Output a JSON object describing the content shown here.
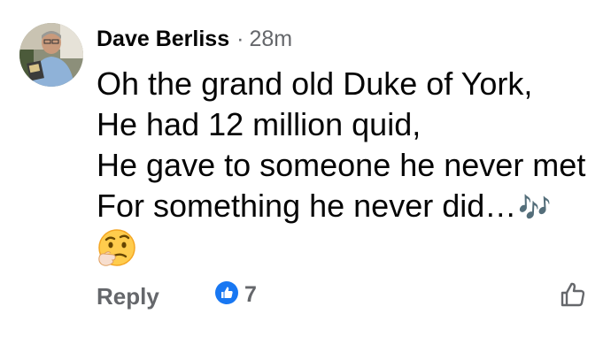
{
  "comment": {
    "author": "Dave Berliss",
    "separator": "·",
    "time": "28m",
    "lines": [
      "Oh the grand old Duke of York,",
      "He had 12 million quid,",
      "He gave to someone he never met",
      "For something he never did…"
    ],
    "music_notes": "🎶",
    "emoji_icon": "thinking-face-icon"
  },
  "actions": {
    "reply_label": "Reply",
    "reaction_count": "7",
    "reaction_icon": "like-badge-icon",
    "like_icon": "thumbs-up-outline-icon"
  },
  "colors": {
    "text": "#050505",
    "secondary": "#65676b",
    "like_blue": "#1877f2"
  }
}
